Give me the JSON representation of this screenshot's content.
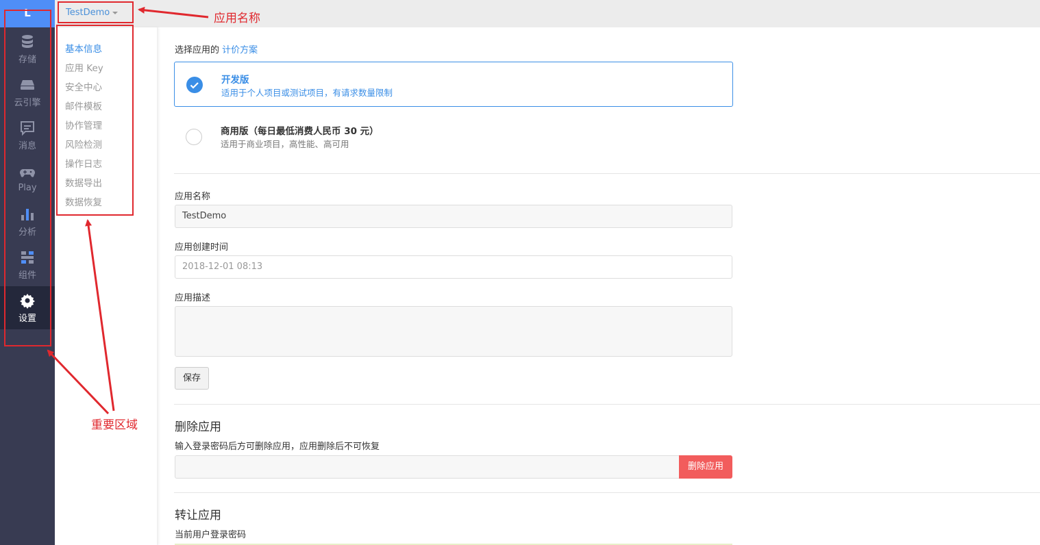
{
  "leftnav": {
    "logo": "L",
    "items": [
      {
        "label": "存储",
        "icon": "database-icon"
      },
      {
        "label": "云引擎",
        "icon": "server-icon"
      },
      {
        "label": "消息",
        "icon": "message-icon"
      },
      {
        "label": "Play",
        "icon": "gamepad-icon"
      },
      {
        "label": "分析",
        "icon": "bar-chart-icon"
      },
      {
        "label": "组件",
        "icon": "components-icon"
      },
      {
        "label": "设置",
        "icon": "gear-icon"
      }
    ],
    "active": "设置"
  },
  "topbar": {
    "app_name": "TestDemo"
  },
  "subnav": {
    "items": [
      "基本信息",
      "应用 Key",
      "安全中心",
      "邮件模板",
      "协作管理",
      "风险检测",
      "操作日志",
      "数据导出",
      "数据恢复"
    ],
    "active": "基本信息"
  },
  "pricing": {
    "prefix": "选择应用的",
    "link": "计价方案",
    "plans": [
      {
        "title": "开发版",
        "desc": "适用于个人项目或测试项目，有请求数量限制",
        "selected": true
      },
      {
        "title": "商用版（每日最低消费人民币 30 元）",
        "desc": "适用于商业项目，高性能、高可用",
        "selected": false
      }
    ]
  },
  "form": {
    "name_label": "应用名称",
    "name_value": "TestDemo",
    "created_label": "应用创建时间",
    "created_value": "2018-12-01 08:13",
    "desc_label": "应用描述",
    "desc_value": "",
    "save_label": "保存"
  },
  "delete": {
    "title": "删除应用",
    "hint": "输入登录密码后方可删除应用，应用删除后不可恢复",
    "button": "删除应用"
  },
  "transfer": {
    "title": "转让应用",
    "password_label": "当前用户登录密码"
  },
  "annotations": {
    "app_name": "应用名称",
    "important_area": "重要区域",
    "color": "#e0282e"
  },
  "colors": {
    "accent": "#3a8ee6",
    "nav_bg": "#383b52",
    "danger": "#f25c5c"
  }
}
